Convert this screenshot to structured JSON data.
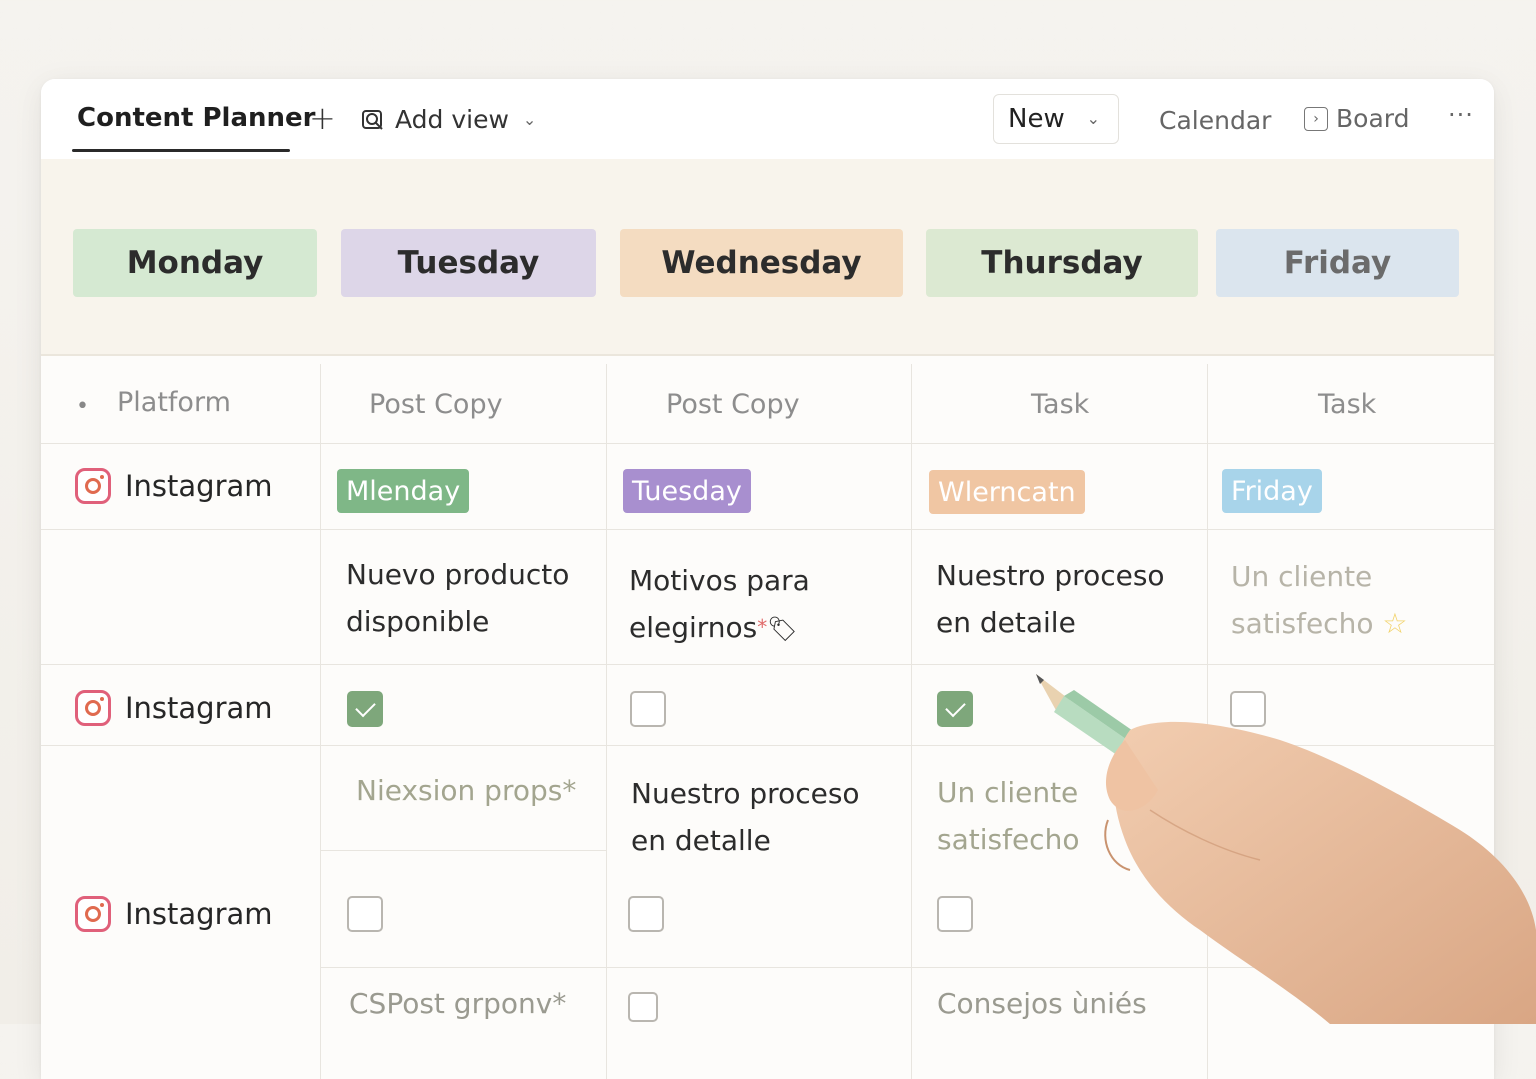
{
  "header": {
    "active_tab": "Content Planner",
    "plus": "+",
    "add_view": "Add view",
    "new_button": "New",
    "calendar": "Calendar",
    "board": "Board",
    "more": "···"
  },
  "days": [
    "Monday",
    "Tuesday",
    "Wednesday",
    "Thursday",
    "Friday"
  ],
  "columns": {
    "platform": "Platform",
    "c1": "Post Copy",
    "c2": "Post Copy",
    "c3": "Task",
    "c4": "Task"
  },
  "rows": {
    "r1": {
      "platform": "Instagram",
      "tags": [
        "Mlenday",
        "Tuesday",
        "Wlerncatn",
        "Friday"
      ]
    },
    "r2": {
      "texts": [
        "Nuevo producto disponible",
        "Motivos para elegirnos",
        "Nuestro proceso en detaile",
        "Un cliente satisfecho"
      ],
      "asterisk": "*"
    },
    "r3": {
      "platform": "Instagram",
      "checks": [
        true,
        false,
        true,
        false
      ]
    },
    "r4": {
      "texts": [
        "Niexsion props*",
        "Nuestro proceso en detalle",
        "Un cliente satisfecho"
      ]
    },
    "r5": {
      "platform": "Instagram",
      "checks": [
        false,
        false,
        false
      ]
    },
    "r6": {
      "texts": [
        "CSPost grponv*",
        "Consejos ùniés"
      ],
      "checks": [
        false
      ]
    }
  },
  "colors": {
    "monday": "#d5e9d2",
    "tuesday": "#ddd6e8",
    "wednesday": "#f4dcc1",
    "thursday": "#dce9d2",
    "friday": "#dbe5ee",
    "tag_green": "#7fb787",
    "tag_purple": "#a88fcf",
    "tag_orange": "#f0c6a3",
    "tag_blue": "#a8d4ea",
    "checked": "#7ea77b"
  },
  "icons": [
    "plus-icon",
    "add-view-icon",
    "chevron-down-icon",
    "board-icon",
    "more-icon",
    "instagram-icon",
    "tag-emoji-icon",
    "star-icon",
    "pencil-in-hand"
  ]
}
